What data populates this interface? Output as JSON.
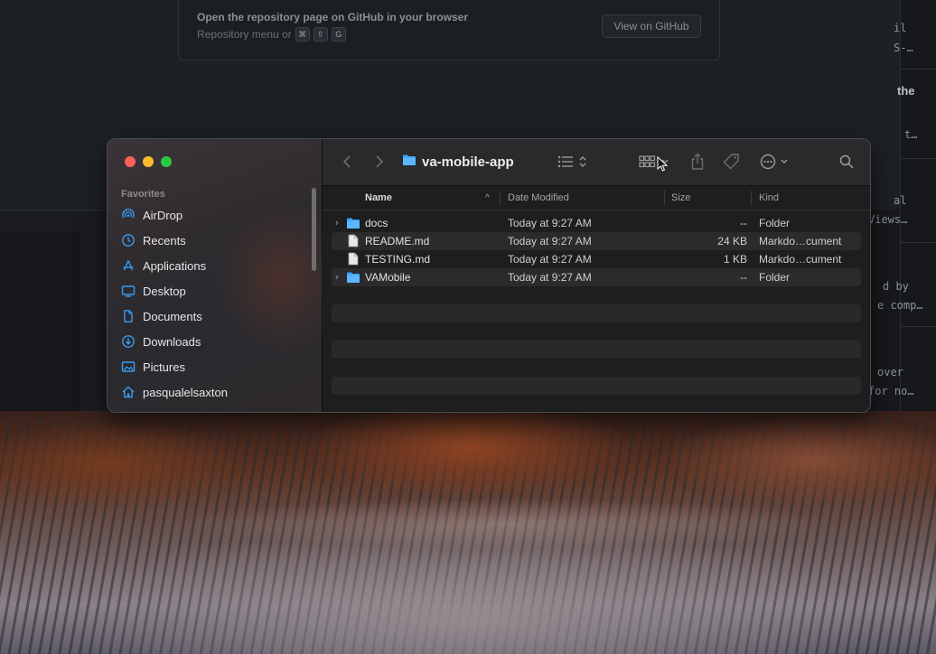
{
  "background_app": {
    "hint_title": "Open the repository page on GitHub in your browser",
    "hint_sub": "Repository menu or",
    "shortcut_keys": [
      "⌘",
      "⇧",
      "G"
    ],
    "view_button": "View on GitHub",
    "fragments": {
      "f1": "il",
      "f2": "S-…",
      "f3": "the",
      "f4": "t…",
      "f5": "al",
      "f6": "Views…",
      "f7": "d by",
      "f8": "e comp…",
      "f9": "over",
      "f10": "for no…"
    }
  },
  "finder": {
    "folder_title": "va-mobile-app",
    "favorites_header": "Favorites",
    "sidebar": [
      {
        "label": "AirDrop",
        "icon": "airdrop-icon"
      },
      {
        "label": "Recents",
        "icon": "clock-icon"
      },
      {
        "label": "Applications",
        "icon": "applications-icon"
      },
      {
        "label": "Desktop",
        "icon": "desktop-icon"
      },
      {
        "label": "Documents",
        "icon": "document-icon"
      },
      {
        "label": "Downloads",
        "icon": "download-icon"
      },
      {
        "label": "Pictures",
        "icon": "pictures-icon"
      },
      {
        "label": "pasqualelsaxton",
        "icon": "home-icon"
      }
    ],
    "columns": {
      "name": "Name",
      "date": "Date Modified",
      "size": "Size",
      "kind": "Kind"
    },
    "files": [
      {
        "name": "docs",
        "date": "Today at 9:27 AM",
        "size": "--",
        "kind": "Folder",
        "type": "folder"
      },
      {
        "name": "README.md",
        "date": "Today at 9:27 AM",
        "size": "24 KB",
        "kind": "Markdo…cument",
        "type": "file"
      },
      {
        "name": "TESTING.md",
        "date": "Today at 9:27 AM",
        "size": "1 KB",
        "kind": "Markdo…cument",
        "type": "file"
      },
      {
        "name": "VAMobile",
        "date": "Today at 9:27 AM",
        "size": "--",
        "kind": "Folder",
        "type": "folder"
      }
    ]
  },
  "colors": {
    "close": "#fe5f57",
    "minimize": "#febc2e",
    "maximize": "#28c840",
    "accent": "#2f9bea"
  }
}
